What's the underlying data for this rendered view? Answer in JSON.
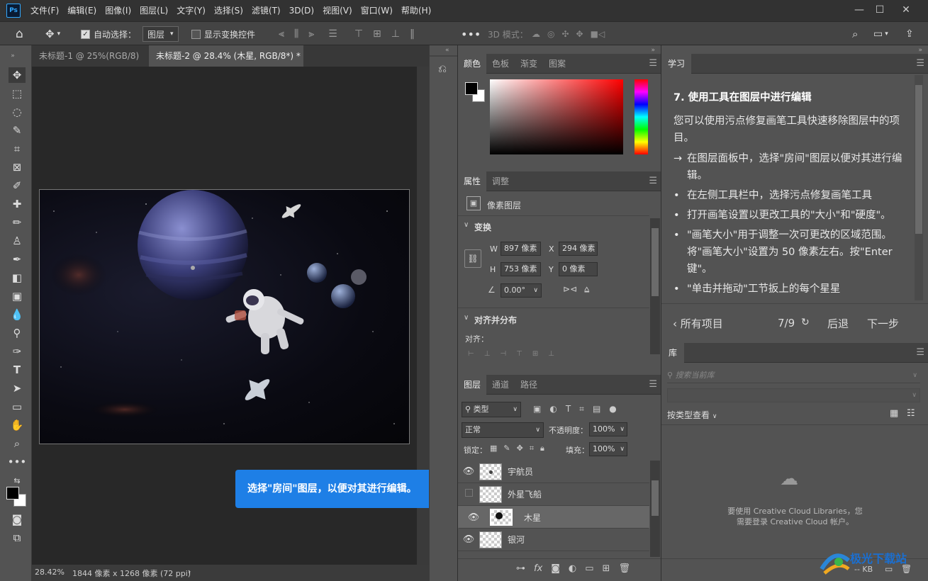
{
  "app": {
    "logo": "Ps"
  },
  "menu": [
    "文件(F)",
    "编辑(E)",
    "图像(I)",
    "图层(L)",
    "文字(Y)",
    "选择(S)",
    "滤镜(T)",
    "3D(D)",
    "视图(V)",
    "窗口(W)",
    "帮助(H)"
  ],
  "window_controls": {
    "minimize": "—",
    "maximize": "☐",
    "close": "✕"
  },
  "options": {
    "auto_select_label": "自动选择：",
    "auto_select_value": "图层",
    "show_transform_label": "显示变换控件",
    "three_d_mode": "3D 模式："
  },
  "doc_tabs": [
    {
      "label": "未标题-1 @ 25%(RGB/8)",
      "close": "×"
    },
    {
      "label": "未标题-2 @ 28.4% (木星, RGB/8*) *",
      "close": "×"
    }
  ],
  "status": {
    "zoom": "28.42%",
    "info": "1844 像素 x 1268 像素 (72 ppi)",
    "arrow": "›"
  },
  "color_panel": {
    "tabs": [
      "颜色",
      "色板",
      "渐变",
      "图案"
    ]
  },
  "properties_panel": {
    "tabs": [
      "属性",
      "调整"
    ],
    "layer_type": "像素图层",
    "transform_heading": "变换",
    "w_label": "W",
    "w_value": "897 像素",
    "x_label": "X",
    "x_value": "294 像素",
    "h_label": "H",
    "h_value": "753 像素",
    "y_label": "Y",
    "y_value": "0 像素",
    "angle_value": "0.00°",
    "align_heading": "对齐并分布",
    "align_label": "对齐："
  },
  "layers_panel": {
    "tabs": [
      "图层",
      "通道",
      "路径"
    ],
    "filter_value": "类型",
    "blend_mode": "正常",
    "opacity_label": "不透明度：",
    "opacity_value": "100%",
    "lock_label": "锁定：",
    "fill_label": "填充：",
    "fill_value": "100%",
    "layers": [
      {
        "name": "宇航员",
        "visible": true,
        "selected": false
      },
      {
        "name": "外星飞船",
        "visible": false,
        "selected": false
      },
      {
        "name": "木星",
        "visible": true,
        "selected": true
      },
      {
        "name": "银河",
        "visible": true,
        "selected": false
      }
    ],
    "footer_icons": [
      "link-icon",
      "fx-icon",
      "mask-icon",
      "adjustment-icon",
      "folder-icon",
      "new-layer-icon",
      "trash-icon"
    ],
    "fx_label": "fx"
  },
  "tooltip": "选择\"房间\"图层，以便对其进行编辑。",
  "learn_panel": {
    "tab": "学习",
    "heading": "7. 使用工具在图层中进行编辑",
    "intro": "您可以使用污点修复画笔工具快速移除图层中的项目。",
    "steps": [
      "在图层面板中，选择\"房间\"图层以便对其进行编辑。",
      "在左侧工具栏中，选择污点修复画笔工具",
      "打开画笔设置以更改工具的\"大小\"和\"硬度\"。",
      "\"画笔大小\"用于调整一次可更改的区域范围。将\"画笔大小\"设置为 50 像素左右。按\"Enter 键\"。",
      "\"单击并拖动\"工节扳上的每个星星"
    ],
    "back_all": "所有项目",
    "progress": "7/9",
    "prev": "后退",
    "next": "下一步"
  },
  "library_panel": {
    "tab": "库",
    "search_placeholder": "搜索当前库",
    "view_by": "按类型查看",
    "empty_line1": "要使用 Creative Cloud Libraries，您",
    "empty_line2": "需要登录 Creative Cloud 帐户。",
    "footer_kb": "-- KB"
  },
  "watermark": "极光下载站"
}
